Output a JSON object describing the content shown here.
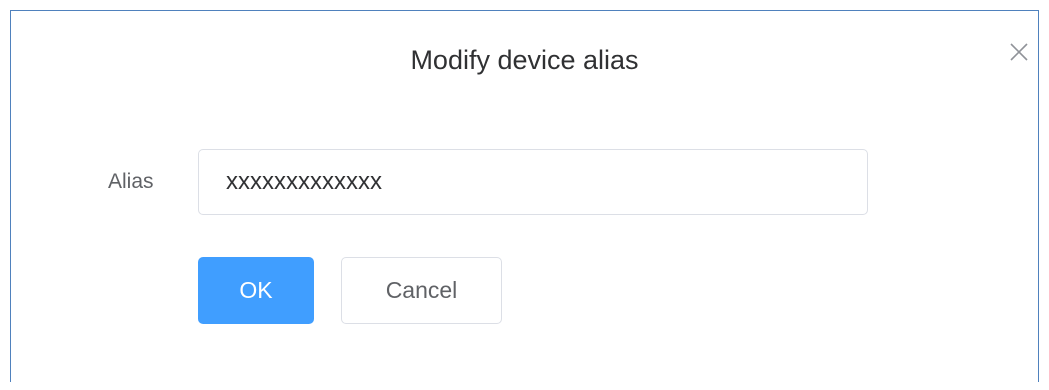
{
  "dialog": {
    "title": "Modify device alias",
    "close_icon": "close-icon"
  },
  "form": {
    "alias_label": "Alias",
    "alias_value": "xxxxxxxxxxxxx"
  },
  "buttons": {
    "ok_label": "OK",
    "cancel_label": "Cancel"
  },
  "colors": {
    "primary": "#409eff",
    "dialog_border": "#4f81bd",
    "input_border": "#dcdfe6",
    "title_text": "#303133",
    "label_text": "#606266"
  }
}
